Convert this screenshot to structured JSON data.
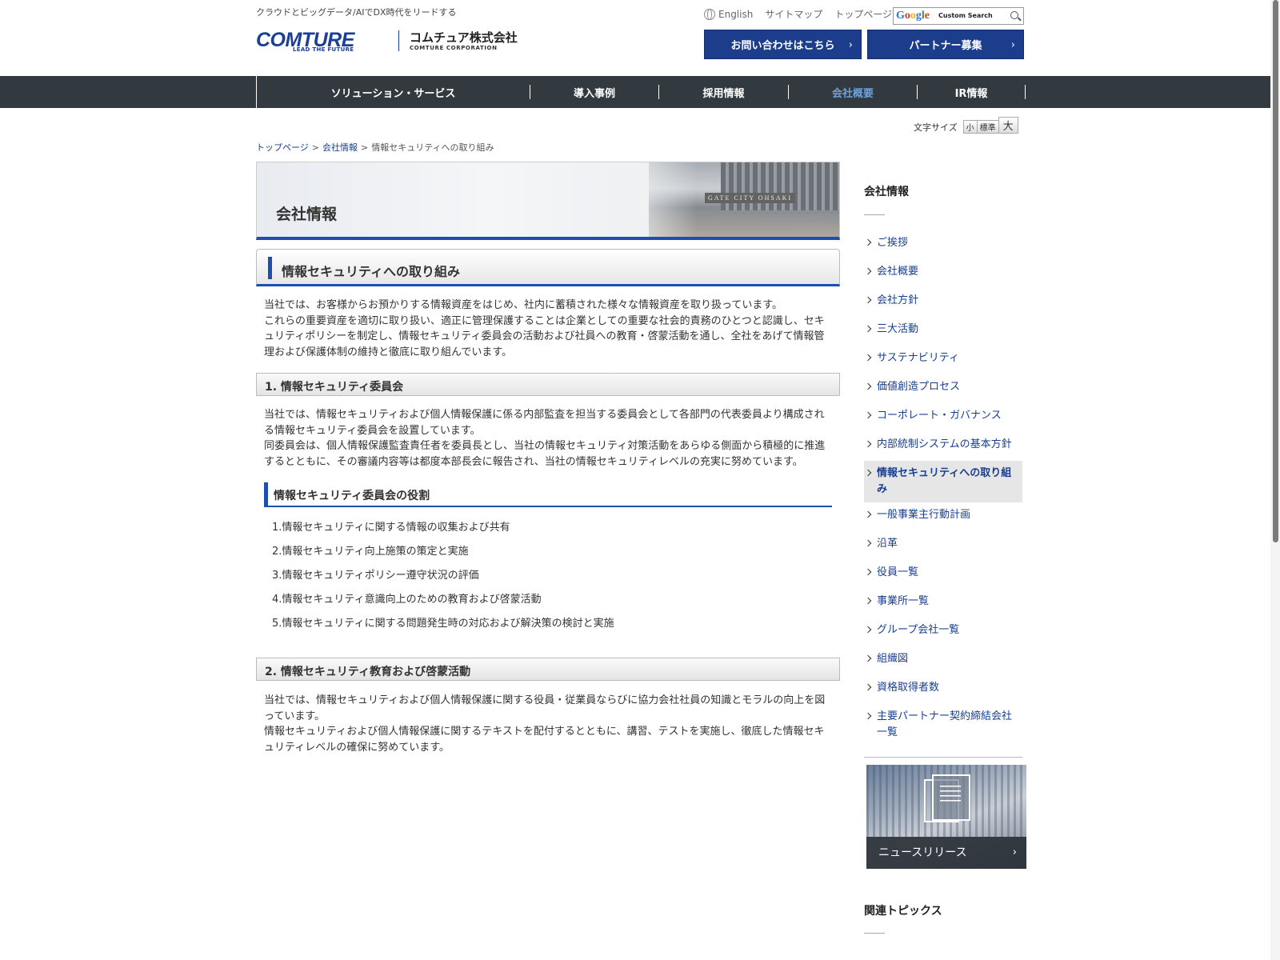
{
  "header": {
    "tagline": "クラウドとビッグデータ/AIでDX時代をリードする",
    "logo_en": "COMTURE",
    "logo_en_sub": "LEAD THE FUTURE",
    "logo_jp": "コムチュア株式会社",
    "logo_jp_sub": "COMTURE CORPORATION",
    "links": {
      "english": "English",
      "sitemap": "サイトマップ",
      "top": "トップページ"
    },
    "search": {
      "brand": "Google",
      "label": "Custom Search",
      "icon": "search-icon"
    },
    "cta": [
      {
        "label": "お問い合わせはこちら"
      },
      {
        "label": "パートナー募集"
      }
    ]
  },
  "global_nav": {
    "items": [
      {
        "label": "ソリューション・サービス",
        "active": false
      },
      {
        "label": "導入事例",
        "active": false
      },
      {
        "label": "採用情報",
        "active": false
      },
      {
        "label": "会社概要",
        "active": true
      },
      {
        "label": "IR情報",
        "active": false
      }
    ],
    "active_color": "#6fa0d8"
  },
  "font_size": {
    "label": "文字サイズ",
    "small": "小",
    "normal": "標準",
    "large": "大"
  },
  "breadcrumb": {
    "top": "トップページ",
    "company": "会社情報",
    "current": "情報セキュリティへの取り組み",
    "separator": ">"
  },
  "main": {
    "hero_title": "会社情報",
    "page_title": "情報セキュリティへの取り組み",
    "intro": [
      "当社では、お客様からお預かりする情報資産をはじめ、社内に蓄積された様々な情報資産を取り扱っています。",
      "これらの重要資産を適切に取り扱い、適正に管理保護することは企業としての重要な社会的責務のひとつと認識し、セキュリティポリシーを制定し、情報セキュリティ委員会の活動および社員への教育・啓蒙活動を通し、全社をあげて情報管理および保護体制の維持と徹底に取り組んでいます。"
    ],
    "section1": {
      "title": "1. 情報セキュリティ委員会",
      "body": [
        "当社では、情報セキュリティおよび個人情報保護に係る内部監査を担当する委員会として各部門の代表委員より構成される情報セキュリティ委員会を設置しています。",
        "同委員会は、個人情報保護監査責任者を委員長とし、当社の情報セキュリティ対策活動をあらゆる側面から積極的に推進するとともに、その審議内容等は都度本部長会に報告され、当社の情報セキュリティレベルの充実に努めています。"
      ],
      "sub_title": "情報セキュリティ委員会の役割",
      "roles": [
        "1.情報セキュリティに関する情報の収集および共有",
        "2.情報セキュリティ向上施策の策定と実施",
        "3.情報セキュリティポリシー遵守状況の評価",
        "4.情報セキュリティ意識向上のための教育および啓蒙活動",
        "5.情報セキュリティに関する問題発生時の対応および解決策の検討と実施"
      ]
    },
    "section2": {
      "title": "2. 情報セキュリティ教育および啓蒙活動",
      "body": [
        "当社では、情報セキュリティおよび個人情報保護に関する役員・従業員ならびに協力会社社員の知識とモラルの向上を図っています。",
        "情報セキュリティおよび個人情報保護に関するテキストを配付するとともに、講習、テストを実施し、徹底した情報セキュリティレベルの確保に努めています。"
      ]
    }
  },
  "sidebar": {
    "heading": "会社情報",
    "items": [
      {
        "label": "ご挨拶"
      },
      {
        "label": "会社概要"
      },
      {
        "label": "会社方針"
      },
      {
        "label": "三大活動"
      },
      {
        "label": "サステナビリティ"
      },
      {
        "label": "価値創造プロセス"
      },
      {
        "label": "コーポレート・ガバナンス"
      },
      {
        "label": "内部統制システムの基本方針"
      },
      {
        "label": "情報セキュリティへの取り組み",
        "current": true
      },
      {
        "label": "一般事業主行動計画"
      },
      {
        "label": "沿革"
      },
      {
        "label": "役員一覧"
      },
      {
        "label": "事業所一覧"
      },
      {
        "label": "グループ会社一覧"
      },
      {
        "label": "組織図"
      },
      {
        "label": "資格取得者数"
      },
      {
        "label": "主要パートナー契約締結会社一覧"
      }
    ],
    "news_banner": "ニュースリリース",
    "related_heading": "関連トピックス"
  },
  "colors": {
    "brand_blue": "#1c3c8c",
    "accent_blue": "#1c4fb0",
    "nav_bg": "#323a40"
  }
}
